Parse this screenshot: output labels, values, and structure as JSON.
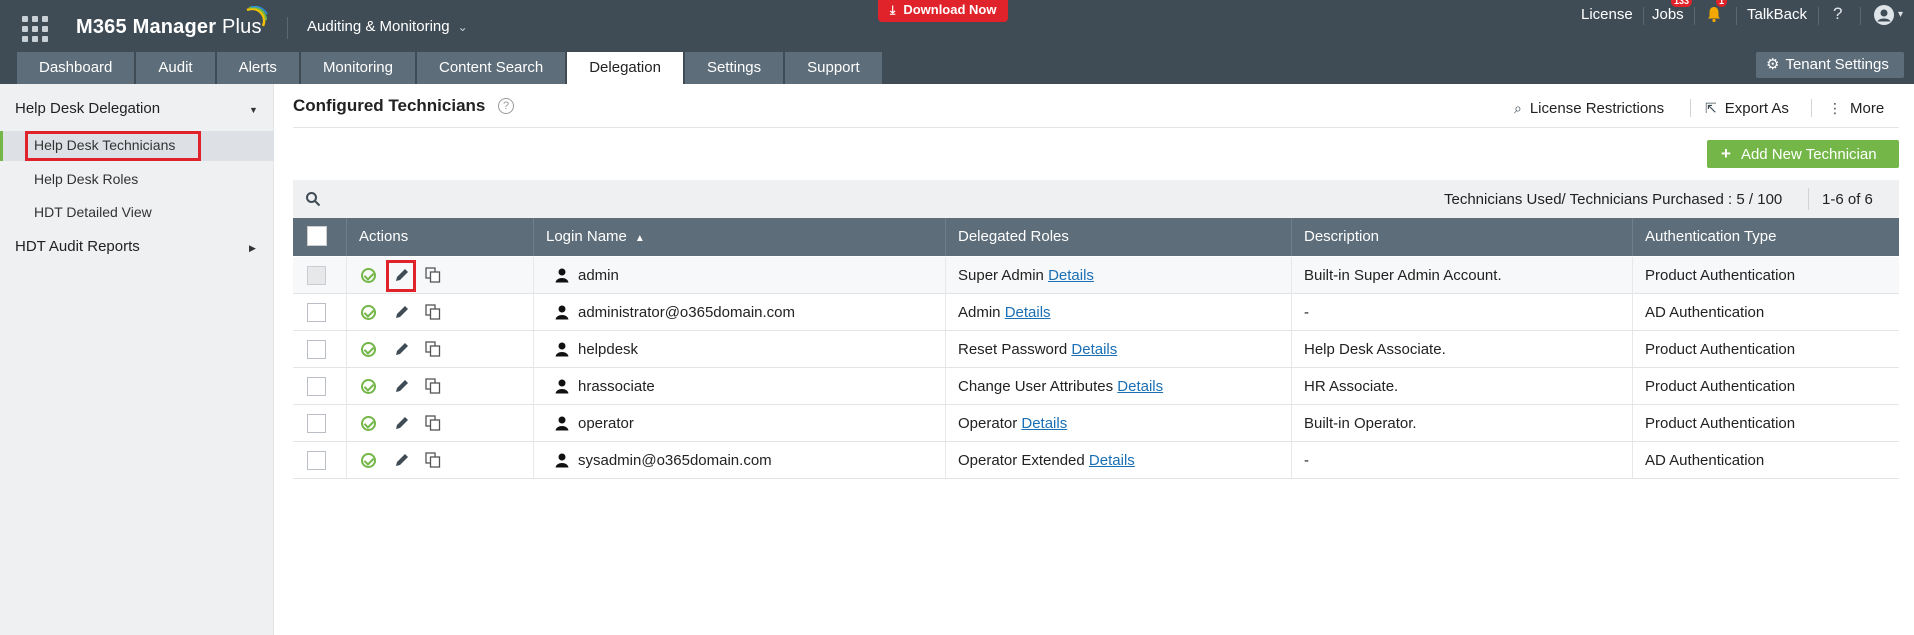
{
  "app": {
    "brand_main": "M365 Manager",
    "brand_plus": "Plus",
    "module": "Auditing & Monitoring",
    "download_label": "Download Now"
  },
  "topnav": {
    "license": "License",
    "jobs": "Jobs",
    "jobs_badge": "133",
    "bell_badge": "1",
    "talkback": "TalkBack",
    "help": "?"
  },
  "tabs": [
    {
      "label": "Dashboard"
    },
    {
      "label": "Audit"
    },
    {
      "label": "Alerts"
    },
    {
      "label": "Monitoring"
    },
    {
      "label": "Content Search"
    },
    {
      "label": "Delegation",
      "active": true
    },
    {
      "label": "Settings"
    },
    {
      "label": "Support"
    }
  ],
  "tenant_settings": "Tenant Settings",
  "sidebar": {
    "section1": "Help Desk Delegation",
    "items": [
      {
        "label": "Help Desk Technicians",
        "active": true
      },
      {
        "label": "Help Desk Roles"
      },
      {
        "label": "HDT Detailed View"
      }
    ],
    "section2": "HDT Audit Reports"
  },
  "main": {
    "title": "Configured Technicians",
    "help_mark": "?",
    "license_restrictions": "License Restrictions",
    "export_as": "Export As",
    "more": "More",
    "add_button": "Add New Technician",
    "count_text": "Technicians Used/ Technicians Purchased : 5 / 100",
    "range_text": "1-6 of 6"
  },
  "table": {
    "headers": {
      "actions": "Actions",
      "login": "Login Name",
      "roles": "Delegated Roles",
      "description": "Description",
      "auth": "Authentication Type"
    },
    "details_label": "Details",
    "rows": [
      {
        "login": "admin",
        "role": "Super Admin",
        "description": "Built-in Super Admin Account.",
        "auth": "Product Authentication"
      },
      {
        "login": "administrator@o365domain.com",
        "role": "Admin",
        "description": "-",
        "auth": "AD Authentication"
      },
      {
        "login": "helpdesk",
        "role": "Reset Password",
        "description": "Help Desk Associate.",
        "auth": "Product Authentication"
      },
      {
        "login": "hrassociate",
        "role": "Change User Attributes",
        "description": "HR Associate.",
        "auth": "Product Authentication"
      },
      {
        "login": "operator",
        "role": "Operator",
        "description": "Built-in Operator.",
        "auth": "Product Authentication"
      },
      {
        "login": "sysadmin@o365domain.com",
        "role": "Operator Extended",
        "description": "-",
        "auth": "AD Authentication"
      }
    ]
  },
  "colors": {
    "topbar": "#3f4c56",
    "tab": "#5d6d79",
    "accent_green": "#74b748",
    "alert_red": "#e0222a",
    "link_blue": "#1a6fb5"
  }
}
